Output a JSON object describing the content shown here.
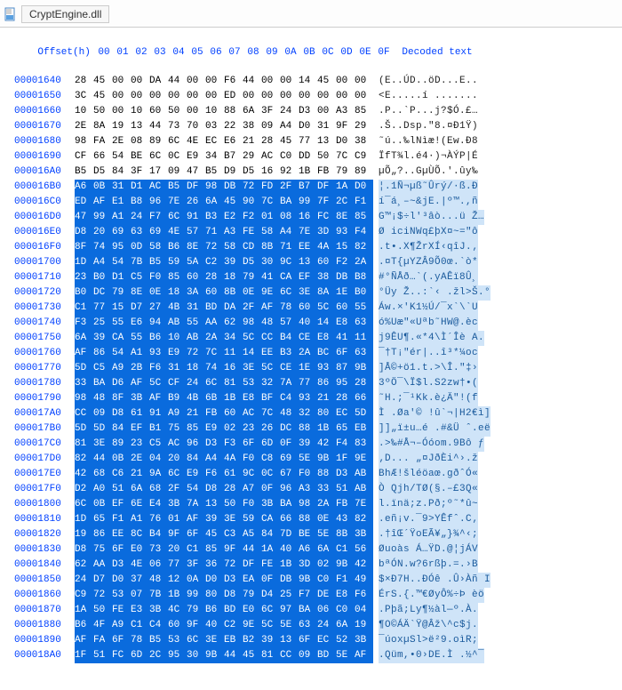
{
  "filename": "CryptEngine.dll",
  "headers": {
    "offset_label": "Offset(h)",
    "columns": [
      "00",
      "01",
      "02",
      "03",
      "04",
      "05",
      "06",
      "07",
      "08",
      "09",
      "0A",
      "0B",
      "0C",
      "0D",
      "0E",
      "0F"
    ],
    "decoded_label": "Decoded text"
  },
  "rows": [
    {
      "offset": "00001640",
      "bytes": [
        "28",
        "45",
        "00",
        "00",
        "DA",
        "44",
        "00",
        "00",
        "F6",
        "44",
        "00",
        "00",
        "14",
        "45",
        "00",
        "00"
      ],
      "decoded": "(E..ÚD..öD...E..",
      "sel_start": 16
    },
    {
      "offset": "00001650",
      "bytes": [
        "3C",
        "45",
        "00",
        "00",
        "00",
        "00",
        "00",
        "00",
        "ED",
        "00",
        "00",
        "00",
        "00",
        "00",
        "00",
        "00"
      ],
      "decoded": "<E.....í .......",
      "sel_start": 16
    },
    {
      "offset": "00001660",
      "bytes": [
        "10",
        "50",
        "00",
        "10",
        "60",
        "50",
        "00",
        "10",
        "88",
        "6A",
        "3F",
        "24",
        "D3",
        "00",
        "A3",
        "85"
      ],
      "decoded": ".P..`P...j?$Ó.£…",
      "sel_start": 16
    },
    {
      "offset": "00001670",
      "bytes": [
        "2E",
        "8A",
        "19",
        "13",
        "44",
        "73",
        "70",
        "03",
        "22",
        "38",
        "09",
        "A4",
        "D0",
        "31",
        "9F",
        "29"
      ],
      "decoded": ".Š..Dsp.\"8.¤Ð1Ÿ)",
      "sel_start": 16
    },
    {
      "offset": "00001680",
      "bytes": [
        "98",
        "FA",
        "2E",
        "08",
        "89",
        "6C",
        "4E",
        "EC",
        "E6",
        "21",
        "28",
        "45",
        "77",
        "13",
        "D0",
        "38"
      ],
      "decoded": "˜ú..‰lNìæ!(Ew.Ð8",
      "sel_start": 16
    },
    {
      "offset": "00001690",
      "bytes": [
        "CF",
        "66",
        "54",
        "BE",
        "6C",
        "0C",
        "E9",
        "34",
        "B7",
        "29",
        "AC",
        "C0",
        "DD",
        "50",
        "7C",
        "C9"
      ],
      "decoded": "ÏfT¾l.é4·)¬ÀÝP|É",
      "sel_start": 16
    },
    {
      "offset": "000016A0",
      "bytes": [
        "B5",
        "D5",
        "84",
        "3F",
        "17",
        "09",
        "47",
        "B5",
        "D9",
        "D5",
        "16",
        "92",
        "1B",
        "FB",
        "79",
        "89"
      ],
      "decoded": "µÕ„?..GµÙÕ.'.ûy‰",
      "sel_start": 16
    },
    {
      "offset": "000016B0",
      "bytes": [
        "A6",
        "0B",
        "31",
        "D1",
        "AC",
        "B5",
        "DF",
        "98",
        "DB",
        "72",
        "FD",
        "2F",
        "B7",
        "DF",
        "1A",
        "D0"
      ],
      "decoded": "¦.1Ñ¬µß˜Ûrý/·ß.Ð",
      "sel_start": 0
    },
    {
      "offset": "000016C0",
      "bytes": [
        "ED",
        "AF",
        "E1",
        "B8",
        "96",
        "7E",
        "26",
        "6A",
        "45",
        "90",
        "7C",
        "BA",
        "99",
        "7F",
        "2C",
        "F1"
      ],
      "decoded": "í¯á¸–~&jE.|º™.,ñ",
      "sel_start": 0
    },
    {
      "offset": "000016D0",
      "bytes": [
        "47",
        "99",
        "A1",
        "24",
        "F7",
        "6C",
        "91",
        "B3",
        "E2",
        "F2",
        "01",
        "08",
        "16",
        "FC",
        "8E",
        "85"
      ],
      "decoded": "G™¡$÷l'³âò...ü Ž…",
      "sel_start": 0
    },
    {
      "offset": "000016E0",
      "bytes": [
        "D8",
        "20",
        "69",
        "63",
        "69",
        "4E",
        "57",
        "71",
        "A3",
        "FE",
        "58",
        "A4",
        "7E",
        "3D",
        "93",
        "F4"
      ],
      "decoded": "Ø iciNWq£þX¤~=\"ô",
      "sel_start": 0
    },
    {
      "offset": "000016F0",
      "bytes": [
        "8F",
        "74",
        "95",
        "0D",
        "58",
        "B6",
        "8E",
        "72",
        "58",
        "CD",
        "8B",
        "71",
        "EE",
        "4A",
        "15",
        "82"
      ],
      "decoded": ".t•.X¶ŽrXÍ‹qîJ.‚",
      "sel_start": 0
    },
    {
      "offset": "00001700",
      "bytes": [
        "1D",
        "A4",
        "54",
        "7B",
        "B5",
        "59",
        "5A",
        "C2",
        "39",
        "D5",
        "30",
        "9C",
        "13",
        "60",
        "F2",
        "2A"
      ],
      "decoded": ".¤T{µYZÂ9Õ0œ.`ò*",
      "sel_start": 0
    },
    {
      "offset": "00001710",
      "bytes": [
        "23",
        "B0",
        "D1",
        "C5",
        "F0",
        "85",
        "60",
        "28",
        "18",
        "79",
        "41",
        "CA",
        "EF",
        "38",
        "DB",
        "B8"
      ],
      "decoded": "#°ÑÅð…`(.yAÊï8Û¸",
      "sel_start": 0
    },
    {
      "offset": "00001720",
      "bytes": [
        "B0",
        "DC",
        "79",
        "8E",
        "0E",
        "18",
        "3A",
        "60",
        "8B",
        "0E",
        "9E",
        "6C",
        "3E",
        "8A",
        "1E",
        "B0"
      ],
      "decoded": "°Üy Ž..:`‹ .žl>Š.°",
      "sel_start": 0
    },
    {
      "offset": "00001730",
      "bytes": [
        "C1",
        "77",
        "15",
        "D7",
        "27",
        "4B",
        "31",
        "BD",
        "DA",
        "2F",
        "AF",
        "78",
        "60",
        "5C",
        "60",
        "55"
      ],
      "decoded": "Áw.×'K1½Ú/¯x`\\`U",
      "sel_start": 0
    },
    {
      "offset": "00001740",
      "bytes": [
        "F3",
        "25",
        "55",
        "E6",
        "94",
        "AB",
        "55",
        "AA",
        "62",
        "98",
        "48",
        "57",
        "40",
        "14",
        "E8",
        "63"
      ],
      "decoded": "ó%Uæ\"«Uªb˜HW@.èc",
      "sel_start": 0
    },
    {
      "offset": "00001750",
      "bytes": [
        "6A",
        "39",
        "CA",
        "55",
        "B6",
        "10",
        "AB",
        "2A",
        "34",
        "5C",
        "CC",
        "B4",
        "CE",
        "E8",
        "41",
        "11"
      ],
      "decoded": "j9ÊU¶.«*4\\Ì´Îè A.",
      "sel_start": 0
    },
    {
      "offset": "00001760",
      "bytes": [
        "AF",
        "86",
        "54",
        "A1",
        "93",
        "E9",
        "72",
        "7C",
        "11",
        "14",
        "EE",
        "B3",
        "2A",
        "BC",
        "6F",
        "63"
      ],
      "decoded": "¯†T¡\"ér|..î³*¼oc",
      "sel_start": 0
    },
    {
      "offset": "00001770",
      "bytes": [
        "5D",
        "C5",
        "A9",
        "2B",
        "F6",
        "31",
        "18",
        "74",
        "16",
        "3E",
        "5C",
        "CE",
        "1E",
        "93",
        "87",
        "9B"
      ],
      "decoded": "]Å©+ö1.t.>\\Î.\"‡›",
      "sel_start": 0
    },
    {
      "offset": "00001780",
      "bytes": [
        "33",
        "BA",
        "D6",
        "AF",
        "5C",
        "CF",
        "24",
        "6C",
        "81",
        "53",
        "32",
        "7A",
        "77",
        "86",
        "95",
        "28"
      ],
      "decoded": "3ºÖ¯\\Ï$l.S2zw†•(",
      "sel_start": 0
    },
    {
      "offset": "00001790",
      "bytes": [
        "98",
        "48",
        "8F",
        "3B",
        "AF",
        "B9",
        "4B",
        "6B",
        "1B",
        "E8",
        "BF",
        "C4",
        "93",
        "21",
        "28",
        "66"
      ],
      "decoded": "˜H.;¯¹Kk.è¿Ä\"!(f",
      "sel_start": 0
    },
    {
      "offset": "000017A0",
      "bytes": [
        "CC",
        "09",
        "D8",
        "61",
        "91",
        "A9",
        "21",
        "FB",
        "60",
        "AC",
        "7C",
        "48",
        "32",
        "80",
        "EC",
        "5D"
      ],
      "decoded": "Ì .Øa'© !û`¬|H2€ì]",
      "sel_start": 0
    },
    {
      "offset": "000017B0",
      "bytes": [
        "5D",
        "5D",
        "84",
        "EF",
        "B1",
        "75",
        "85",
        "E9",
        "02",
        "23",
        "26",
        "DC",
        "88",
        "1B",
        "65",
        "EB"
      ],
      "decoded": "]]„ï±u…é .#&Ü ˆ.eë",
      "sel_start": 0
    },
    {
      "offset": "000017C0",
      "bytes": [
        "81",
        "3E",
        "89",
        "23",
        "C5",
        "AC",
        "96",
        "D3",
        "F3",
        "6F",
        "6D",
        "0F",
        "39",
        "42",
        "F4",
        "83"
      ],
      "decoded": ".>‰#Å¬–Óóom.9Bô ƒ",
      "sel_start": 0
    },
    {
      "offset": "000017D0",
      "bytes": [
        "82",
        "44",
        "0B",
        "2E",
        "04",
        "20",
        "84",
        "A4",
        "4A",
        "F0",
        "C8",
        "69",
        "5E",
        "9B",
        "1F",
        "9E"
      ],
      "decoded": "‚D... „¤JðÈi^›.ž",
      "sel_start": 0
    },
    {
      "offset": "000017E0",
      "bytes": [
        "42",
        "68",
        "C6",
        "21",
        "9A",
        "6C",
        "E9",
        "F6",
        "61",
        "9C",
        "0C",
        "67",
        "F0",
        "88",
        "D3",
        "AB"
      ],
      "decoded": "BhÆ!šléöaœ.gðˆÓ«",
      "sel_start": 0
    },
    {
      "offset": "000017F0",
      "bytes": [
        "D2",
        "A0",
        "51",
        "6A",
        "68",
        "2F",
        "54",
        "D8",
        "28",
        "A7",
        "0F",
        "96",
        "A3",
        "33",
        "51",
        "AB"
      ],
      "decoded": "Ò Qjh/TØ(§.–£3Q«",
      "sel_start": 0
    },
    {
      "offset": "00001800",
      "bytes": [
        "6C",
        "0B",
        "EF",
        "6E",
        "E4",
        "3B",
        "7A",
        "13",
        "50",
        "F0",
        "3B",
        "BA",
        "98",
        "2A",
        "FB",
        "7E"
      ],
      "decoded": "l.ïnä;z.Pð;º˜*û~",
      "sel_start": 0
    },
    {
      "offset": "00001810",
      "bytes": [
        "1D",
        "65",
        "F1",
        "A1",
        "76",
        "01",
        "AF",
        "39",
        "3E",
        "59",
        "CA",
        "66",
        "88",
        "0E",
        "43",
        "82"
      ],
      "decoded": ".eñ¡v.¯9>YÊfˆ.C‚",
      "sel_start": 0
    },
    {
      "offset": "00001820",
      "bytes": [
        "19",
        "86",
        "EE",
        "8C",
        "B4",
        "9F",
        "6F",
        "45",
        "C3",
        "A5",
        "84",
        "7D",
        "BE",
        "5E",
        "8B",
        "3B"
      ],
      "decoded": ".†îŒ´ŸoEÃ¥„}¾^‹;",
      "sel_start": 0
    },
    {
      "offset": "00001830",
      "bytes": [
        "D8",
        "75",
        "6F",
        "E0",
        "73",
        "20",
        "C1",
        "85",
        "9F",
        "44",
        "1A",
        "40",
        "A6",
        "6A",
        "C1",
        "56"
      ],
      "decoded": "Øuoàs Á…ŸD.@¦jÁV",
      "sel_start": 0
    },
    {
      "offset": "00001840",
      "bytes": [
        "62",
        "AA",
        "D3",
        "4E",
        "06",
        "77",
        "3F",
        "36",
        "72",
        "DF",
        "FE",
        "1B",
        "3D",
        "02",
        "9B",
        "42"
      ],
      "decoded": "bªÓN.w?6rßþ.=.›B",
      "sel_start": 0
    },
    {
      "offset": "00001850",
      "bytes": [
        "24",
        "D7",
        "D0",
        "37",
        "48",
        "12",
        "0A",
        "D0",
        "D3",
        "EA",
        "0F",
        "DB",
        "9B",
        "C0",
        "F1",
        "49"
      ],
      "decoded": "$×Ð7H..ÐÓê .Û›Àñ I",
      "sel_start": 0
    },
    {
      "offset": "00001860",
      "bytes": [
        "C9",
        "72",
        "53",
        "07",
        "7B",
        "1B",
        "99",
        "80",
        "D8",
        "79",
        "D4",
        "25",
        "F7",
        "DE",
        "E8",
        "F6"
      ],
      "decoded": "ÉrS.{.™€ØyÔ%÷Þ èö",
      "sel_start": 0
    },
    {
      "offset": "00001870",
      "bytes": [
        "1A",
        "50",
        "FE",
        "E3",
        "3B",
        "4C",
        "79",
        "B6",
        "BD",
        "E0",
        "6C",
        "97",
        "BA",
        "06",
        "C0",
        "04"
      ],
      "decoded": ".Pþã;Ly¶½àl—º.À.",
      "sel_start": 0
    },
    {
      "offset": "00001880",
      "bytes": [
        "B6",
        "4F",
        "A9",
        "C1",
        "C4",
        "60",
        "9F",
        "40",
        "C2",
        "9E",
        "5C",
        "5E",
        "63",
        "24",
        "6A",
        "19"
      ],
      "decoded": "¶O©ÁÄ`Ÿ@Âž\\^c$j.",
      "sel_start": 0
    },
    {
      "offset": "00001890",
      "bytes": [
        "AF",
        "FA",
        "6F",
        "78",
        "B5",
        "53",
        "6C",
        "3E",
        "EB",
        "B2",
        "39",
        "13",
        "6F",
        "EC",
        "52",
        "3B"
      ],
      "decoded": "¯úoxµSl>ë²9.oìR;",
      "sel_start": 0
    },
    {
      "offset": "000018A0",
      "bytes": [
        "1F",
        "51",
        "FC",
        "6D",
        "2C",
        "95",
        "30",
        "9B",
        "44",
        "45",
        "81",
        "CC",
        "09",
        "BD",
        "5E",
        "AF"
      ],
      "decoded": ".Qüm,•0›DE.Ì .½^¯",
      "sel_start": 0
    }
  ]
}
